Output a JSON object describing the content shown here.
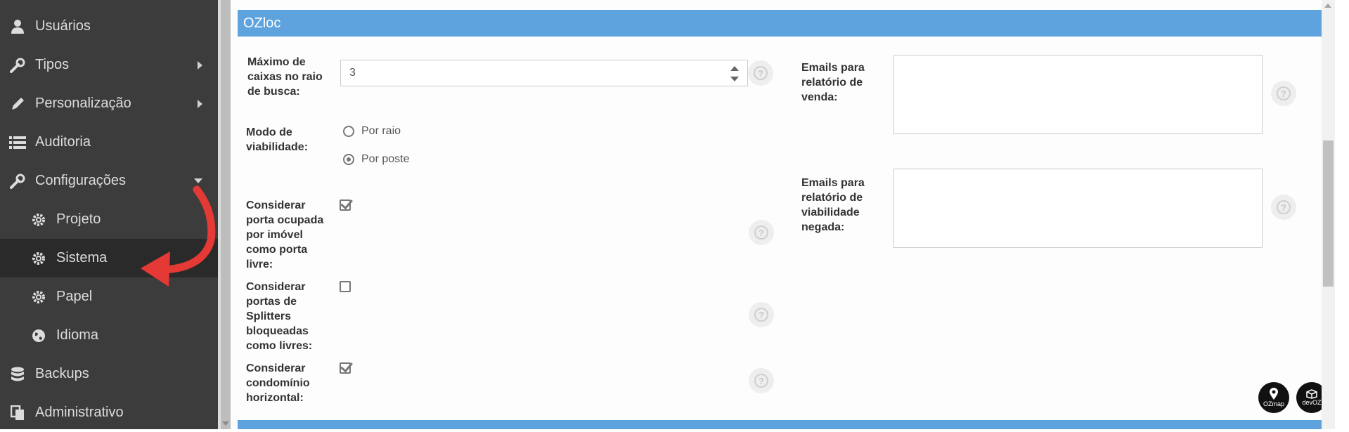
{
  "sidebar": {
    "items": [
      {
        "label": "Usuários",
        "icon": "user-icon"
      },
      {
        "label": "Tipos",
        "icon": "wrench-icon"
      },
      {
        "label": "Personalização",
        "icon": "pencil-icon"
      },
      {
        "label": "Auditoria",
        "icon": "list-icon"
      },
      {
        "label": "Configurações",
        "icon": "wrench-icon"
      },
      {
        "label": "Projeto",
        "icon": "gear-icon"
      },
      {
        "label": "Sistema",
        "icon": "gear-icon"
      },
      {
        "label": "Papel",
        "icon": "gear-icon"
      },
      {
        "label": "Idioma",
        "icon": "globe-icon"
      },
      {
        "label": "Backups",
        "icon": "database-icon"
      },
      {
        "label": "Administrativo",
        "icon": "copy-icon"
      }
    ],
    "active_item": "Sistema"
  },
  "section": {
    "title": "OZloc"
  },
  "form": {
    "max_boxes_label": "Máximo de caixas no raio de busca:",
    "max_boxes_value": "3",
    "viability_mode_label": "Modo de viabilidade:",
    "viability_options": [
      "Por raio",
      "Por poste"
    ],
    "viability_selected": "Por poste",
    "occupied_port_label": "Considerar porta ocupada por imóvel como porta livre:",
    "occupied_port_checked": true,
    "splitter_label": "Considerar portas de Splitters bloqueadas como livres:",
    "splitter_checked": false,
    "condo_label": "Considerar condomínio horizontal:",
    "condo_checked": true,
    "sales_emails_label": "Emails para relatório de venda:",
    "denied_emails_label": "Emails para relatório de viabilidade negada:"
  },
  "badges": [
    {
      "label": "OZmap"
    },
    {
      "label": "devOZ"
    }
  ],
  "colors": {
    "sidebar_bg": "#3c3c3c",
    "header_bg": "#5ea3de",
    "annotation_arrow": "#e53935"
  }
}
